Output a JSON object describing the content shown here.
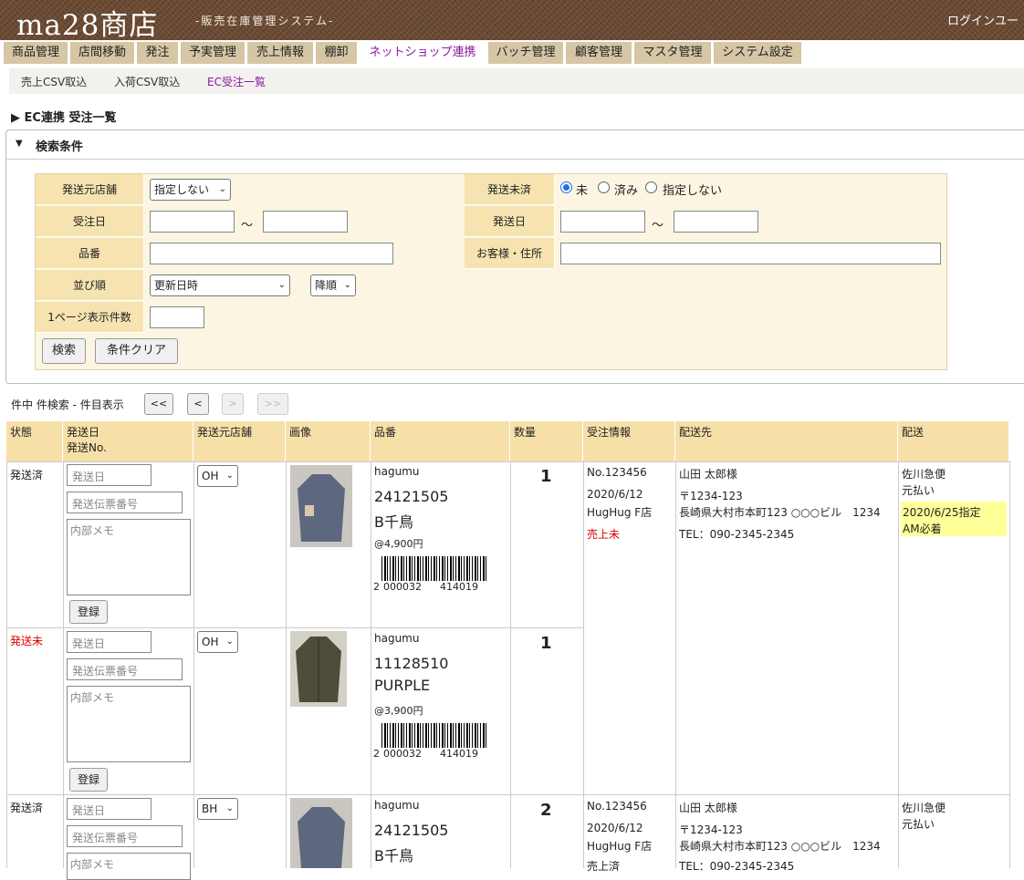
{
  "header": {
    "logo": "ma28商店",
    "subtitle": "-販売在庫管理システム-",
    "login": "ログインユー"
  },
  "nav": {
    "tabs": [
      "商品管理",
      "店間移動",
      "発注",
      "予実管理",
      "売上情報",
      "棚卸",
      "ネットショップ連携",
      "バッチ管理",
      "顧客管理",
      "マスタ管理",
      "システム設定"
    ],
    "active_index": 6
  },
  "subnav": {
    "links": [
      "売上CSV取込",
      "入荷CSV取込",
      "EC受注一覧"
    ],
    "active_index": 2
  },
  "page": {
    "title": "▶ EC連携 受注一覧"
  },
  "search": {
    "header_label": "検索条件",
    "labels": {
      "store": "発送元店舗",
      "ship_status": "発送未済",
      "order_date": "受注日",
      "ship_date": "発送日",
      "item_no": "品番",
      "customer": "お客様・住所",
      "sort": "並び順",
      "per_page": "1ページ表示件数"
    },
    "store_value": "指定しない",
    "radio_options": [
      "未",
      "済み",
      "指定しない"
    ],
    "radio_selected": "未",
    "tilde": "～",
    "sort_value": "更新日時",
    "order_value": "降順",
    "search_button": "検索",
    "clear_button": "条件クリア"
  },
  "pager": {
    "text": "件中 件検索 - 件目表示",
    "first": "<<",
    "prev": "<",
    "next": ">",
    "last": ">>"
  },
  "table": {
    "headers": {
      "status": "状態",
      "ship_date": "発送日",
      "ship_no": "発送No.",
      "store": "発送元店舗",
      "image": "画像",
      "item": "品番",
      "qty": "数量",
      "order_info": "受注情報",
      "dest": "配送先",
      "delivery": "配送"
    },
    "placeholders": {
      "ship_date": "発送日",
      "slip": "発送伝票番号",
      "memo": "内部メモ"
    },
    "register_button": "登録",
    "rows": [
      {
        "status": "発送済",
        "status_red": false,
        "store": "OH",
        "brand": "hagumu",
        "code": "24121505",
        "color": "B千鳥",
        "price": "@4,900円",
        "barcode_lead": "2",
        "barcode_a": "000032",
        "barcode_b": "414019",
        "qty": "1"
      },
      {
        "status": "発送未",
        "status_red": true,
        "store": "OH",
        "brand": "hagumu",
        "code": "11128510",
        "color": "PURPLE",
        "price": "@3,900円",
        "barcode_lead": "2",
        "barcode_a": "000032",
        "barcode_b": "414019",
        "qty": "1"
      },
      {
        "status": "発送済",
        "status_red": false,
        "store": "BH",
        "brand": "hagumu",
        "code": "24121505",
        "color": "B千鳥",
        "price": "",
        "barcode_lead": "",
        "barcode_a": "",
        "barcode_b": "",
        "qty": "2"
      }
    ],
    "orders": [
      {
        "no": "No.123456",
        "date": "2020/6/12",
        "shop": "HugHug F店",
        "sales": "売上未",
        "sales_red": true,
        "name": "山田 太郎様",
        "zip": "〒1234-123",
        "addr": "長崎県大村市本町123 ○○○ビル　1234",
        "tel": "TEL：090-2345-2345",
        "carrier": "佐川急便",
        "pay": "元払い",
        "note1": "2020/6/25指定",
        "note2": "AM必着"
      },
      {
        "no": "No.123456",
        "date": "2020/6/12",
        "shop": "HugHug F店",
        "sales": "売上済",
        "sales_red": false,
        "name": "山田 太郎様",
        "zip": "〒1234-123",
        "addr": "長崎県大村市本町123 ○○○ビル　1234",
        "tel": "TEL：090-2345-2345",
        "carrier": "佐川急便",
        "pay": "元払い",
        "note1": "",
        "note2": ""
      }
    ]
  },
  "colors": {
    "header_bg": "#6b4a32",
    "tab_bg": "#d6c6a6",
    "active_link": "#8a1aa3",
    "form_bg": "#fbf5e2",
    "label_bg": "#f6e3b0",
    "th_bg": "#f6e0a8",
    "warn": "#dd0000",
    "highlight": "#ffff99"
  }
}
